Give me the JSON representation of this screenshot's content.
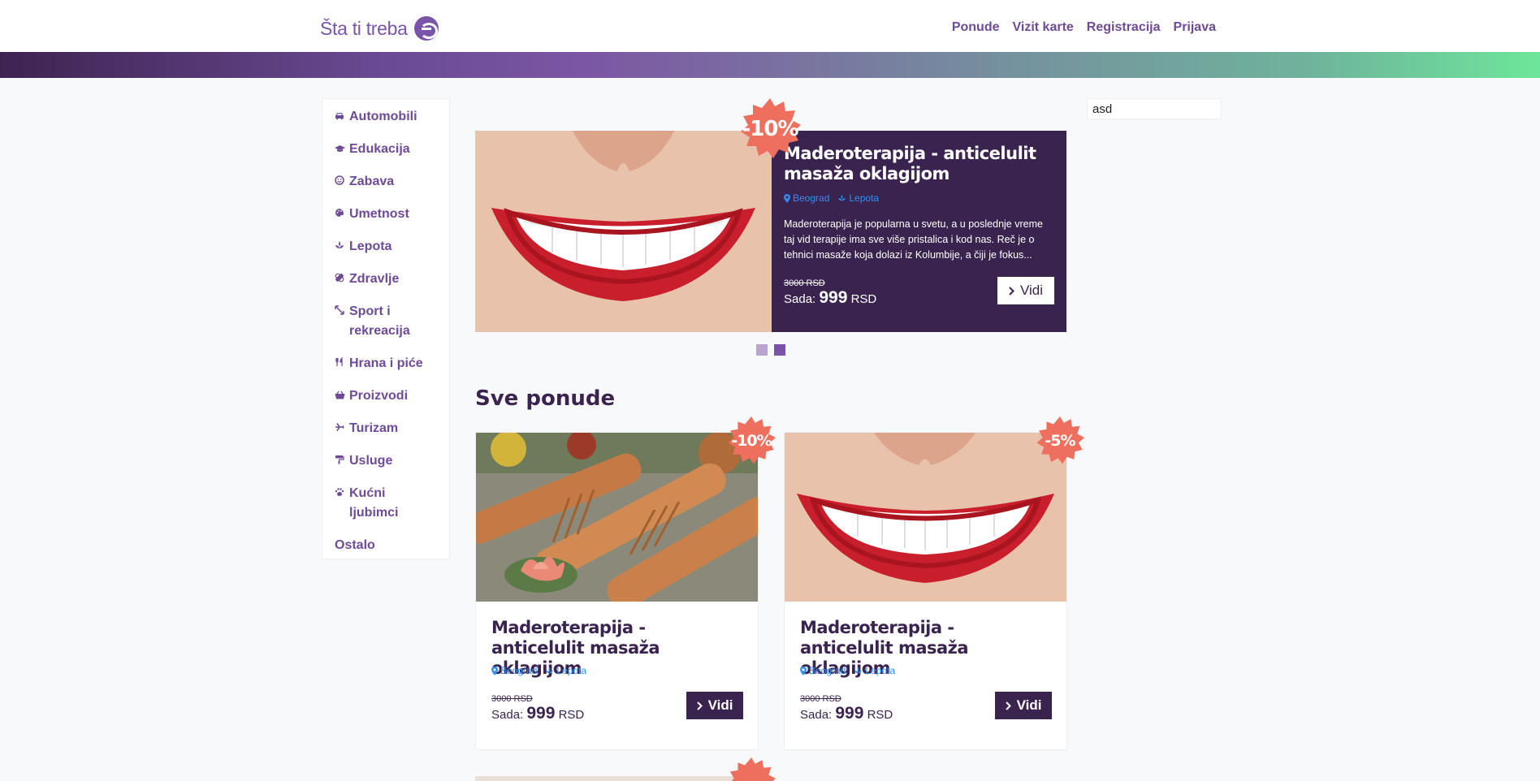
{
  "header": {
    "logo_text": "Šta ti treba",
    "nav": [
      "Ponude",
      "Vizit karte",
      "Registracija",
      "Prijava"
    ]
  },
  "sidebar": {
    "items": [
      {
        "label": "Automobili",
        "icon": "car-icon"
      },
      {
        "label": "Edukacija",
        "icon": "graduation-cap-icon"
      },
      {
        "label": "Zabava",
        "icon": "smile-icon"
      },
      {
        "label": "Umetnost",
        "icon": "palette-icon"
      },
      {
        "label": "Lepota",
        "icon": "spa-icon"
      },
      {
        "label": "Zdravlje",
        "icon": "bandage-icon"
      },
      {
        "label": "Sport i rekreacija",
        "icon": "arrows-icon"
      },
      {
        "label": "Hrana i piće",
        "icon": "utensils-icon"
      },
      {
        "label": "Proizvodi",
        "icon": "basket-icon"
      },
      {
        "label": "Turizam",
        "icon": "plane-icon"
      },
      {
        "label": "Usluge",
        "icon": "paint-roller-icon"
      },
      {
        "label": "Kućni ljubimci",
        "icon": "paw-icon"
      },
      {
        "label": "Ostalo",
        "icon": ""
      }
    ]
  },
  "search": {
    "value": "asd"
  },
  "featured": {
    "discount": "-10%",
    "title": "Maderoterapija - anticelulit masaža oklagijom",
    "city": "Beograd",
    "category": "Lepota",
    "description": "Maderoterapija je popularna u svetu, a u poslednje vreme taj vid terapije ima sve više pristalica i kod nas. Reč je o tehnici masaže koja dolazi iz Kolumbije, a čiji je fokus...",
    "old_price": "3000 RSD",
    "now_label": "Sada:",
    "now_price": "999",
    "currency": "RSD",
    "button": "Vidi"
  },
  "carousel": {
    "slides": 2,
    "active": 2
  },
  "section_title": "Sve ponude",
  "offers": [
    {
      "discount": "-10%",
      "title": "Maderoterapija - anticelulit masaža oklagijom",
      "city": "Beograd",
      "category": "Lepota",
      "old_price": "3000 RSD",
      "now_label": "Sada:",
      "now_price": "999",
      "currency": "RSD",
      "button": "Vidi",
      "image": "wooden-massage-rollers"
    },
    {
      "discount": "-5%",
      "title": "Maderoterapija - anticelulit masaža oklagijom",
      "city": "Beograd",
      "category": "Lepota",
      "old_price": "3000 RSD",
      "now_label": "Sada:",
      "now_price": "999",
      "currency": "RSD",
      "button": "Vidi",
      "image": "smiling-lips"
    }
  ],
  "colors": {
    "brand": "#6e4a97",
    "dark": "#3b2350",
    "badge": "#ef6f5e",
    "tag": "#2f8ff0"
  }
}
